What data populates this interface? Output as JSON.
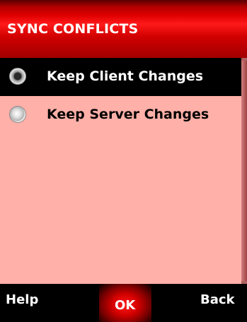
{
  "title": "SYNC CONFLICTS",
  "options": [
    {
      "label": "Keep Client Changes",
      "selected": true
    },
    {
      "label": "Keep Server Changes",
      "selected": false
    }
  ],
  "softkeys": {
    "left": "Help",
    "center": "OK",
    "right": "Back"
  },
  "colors": {
    "title_bar": "#e00000",
    "content_bg": "#ffb0a8",
    "selection_bg": "#000000",
    "softkey_bg": "#000000"
  },
  "icons": {
    "radio_selected": "radio-selected-icon",
    "radio_unselected": "radio-unselected-icon"
  }
}
